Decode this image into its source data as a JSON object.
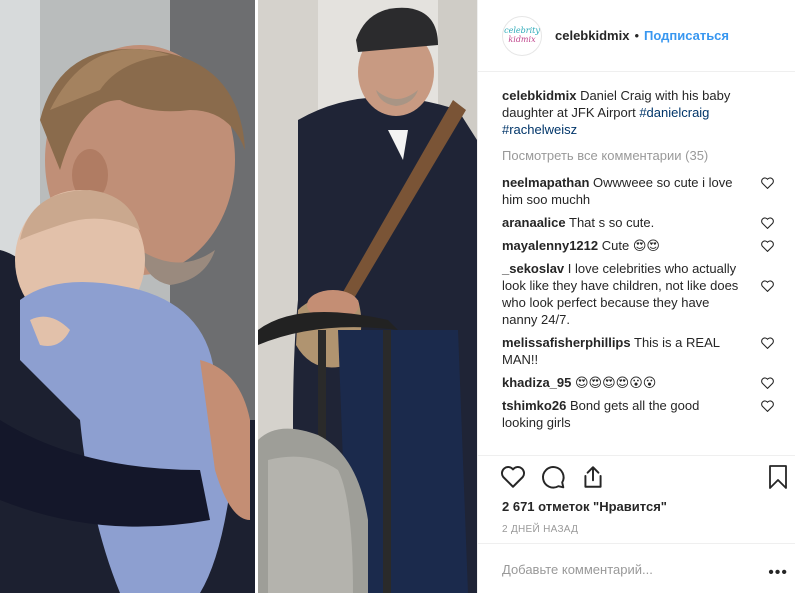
{
  "header": {
    "avatar_line1": "celebrity",
    "avatar_line2": "kidmix",
    "username": "celebkidmix",
    "dot": "•",
    "follow": "Подписаться"
  },
  "caption": {
    "user": "celebkidmix",
    "text": "Daniel Craig with his baby daughter at JFK Airport",
    "tag1": "#danielcraig",
    "tag2": "#rachelweisz"
  },
  "view_all": "Посмотреть все комментарии (35)",
  "comments": [
    {
      "user": "neelmapathan",
      "text": "Owwweee so cute i love him soo muchh"
    },
    {
      "user": "aranaalice",
      "text": "That s so cute."
    },
    {
      "user": "mayalenny1212",
      "text": "Cute 😍😍"
    },
    {
      "user": "_sekoslav",
      "text": "I love celebrities who actually look like they have children, not like does who look perfect because they have nanny 24/7."
    },
    {
      "user": "melissafisherphillips",
      "text": "This is a REAL MAN!!"
    },
    {
      "user": "khadiza_95",
      "text": "😍😍😍😍😮😮"
    },
    {
      "user": "tshimko26",
      "text": "Bond gets all the good looking girls"
    }
  ],
  "likes": "2 671 отметок \"Нравится\"",
  "time": "2 ДНЕЙ НАЗАД",
  "add_comment_placeholder": "Добавьте комментарий...",
  "more": "•••",
  "icons": {
    "like": "heart-icon",
    "comment": "comment-icon",
    "share": "share-icon",
    "save": "bookmark-icon"
  },
  "colors": {
    "link": "#3897f0",
    "hashtag": "#003569",
    "muted": "#999999",
    "text": "#262626"
  }
}
